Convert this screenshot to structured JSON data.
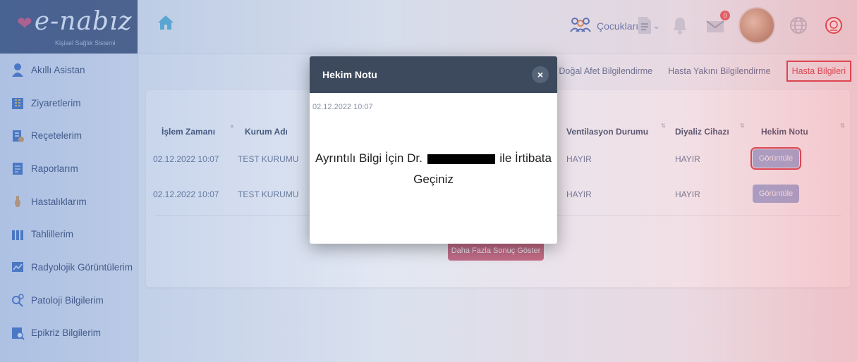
{
  "header": {
    "logo_text": "e-nabız",
    "logo_tagline": "Kişisel Sağlık Sistemi",
    "children_label": "Çocuklarım",
    "notification_count": "0"
  },
  "sidebar": {
    "items": [
      {
        "label": "Akıllı Asistan"
      },
      {
        "label": "Ziyaretlerim"
      },
      {
        "label": "Reçetelerim"
      },
      {
        "label": "Raporlarım"
      },
      {
        "label": "Hastalıklarım"
      },
      {
        "label": "Tahlillerim"
      },
      {
        "label": "Radyolojik Görüntülerim"
      },
      {
        "label": "Patoloji Bilgilerim"
      },
      {
        "label": "Epikriz Bilgilerim"
      }
    ]
  },
  "tabs": {
    "disaster": "Doğal Afet Bilgilendirme",
    "relative": "Hasta Yakını Bilgilendirme",
    "patient": "Hasta Bilgileri"
  },
  "table": {
    "columns": {
      "time": "İşlem Zamanı",
      "institution": "Kurum Adı",
      "ventilation": "Ventilasyon Durumu",
      "dialysis": "Diyaliz Cihazı",
      "note": "Hekim Notu"
    },
    "rows": [
      {
        "time": "02.12.2022 10:07",
        "institution": "TEST KURUMU",
        "ventilation": "HAYIR",
        "dialysis": "HAYIR",
        "action": "Görüntüle"
      },
      {
        "time": "02.12.2022 10:07",
        "institution": "TEST KURUMU",
        "ventilation": "HAYIR",
        "dialysis": "HAYIR",
        "action": "Görüntüle"
      }
    ],
    "more_button": "Daha Fazla Sonuç Göster"
  },
  "modal": {
    "title": "Hekim Notu",
    "close": "×",
    "date": "02.12.2022 10:07",
    "text_before": "Ayrıntılı Bilgi İçin Dr.",
    "text_after": "ile İrtibata",
    "text_line2": "Geçiniz"
  }
}
